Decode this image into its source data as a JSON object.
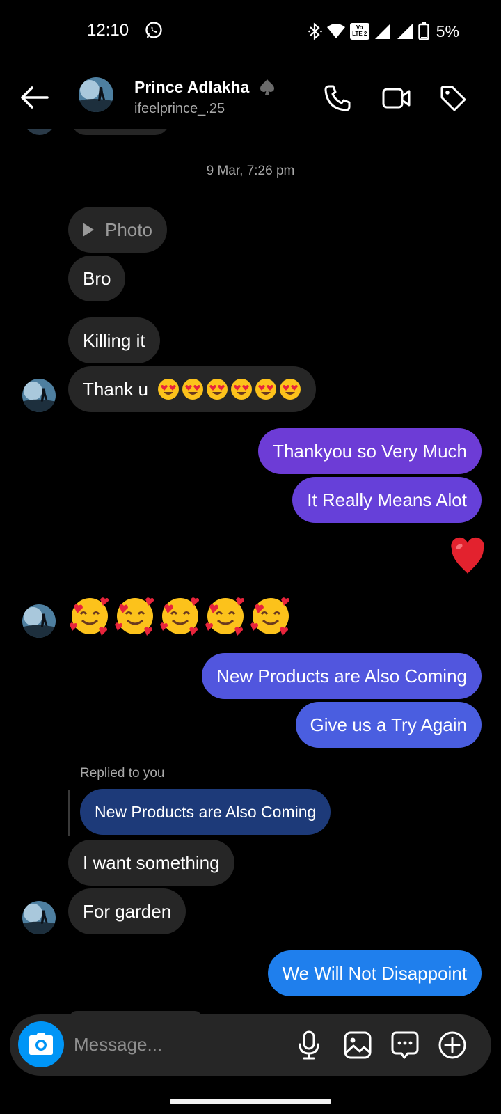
{
  "status_bar": {
    "time": "12:10",
    "battery": "5%",
    "volte": "Vo LTE 2",
    "lte_sub": "1"
  },
  "header": {
    "name": "Prince Adlakha",
    "username": "ifeelprince_.25"
  },
  "chat": {
    "timestamp": "9 Mar, 7:26 pm",
    "photo_label": "Photo",
    "msg_bro": "Bro",
    "msg_killing": "Killing it",
    "msg_thanku": "Thank u",
    "out_1": "Thankyou so Very Much",
    "out_2": "It Really Means Alot",
    "out_3": "New Products are Also Coming",
    "out_4": "Give us a Try Again",
    "replied_label": "Replied to you",
    "reply_quote": "New Products are Also Coming",
    "msg_want": "I want something",
    "msg_garden": "For garden",
    "out_5": "We Will Not Disappoint"
  },
  "composer": {
    "placeholder": "Message..."
  },
  "colors": {
    "out_1": "#6d3cd6",
    "out_2": "#6640d9",
    "out_3": "#5156de",
    "out_4": "#4a5ee0",
    "out_5": "#1f7fed",
    "incoming": "#262626",
    "reply_quote_bg": "#1d3a79",
    "accent_camera": "#0095f6"
  }
}
